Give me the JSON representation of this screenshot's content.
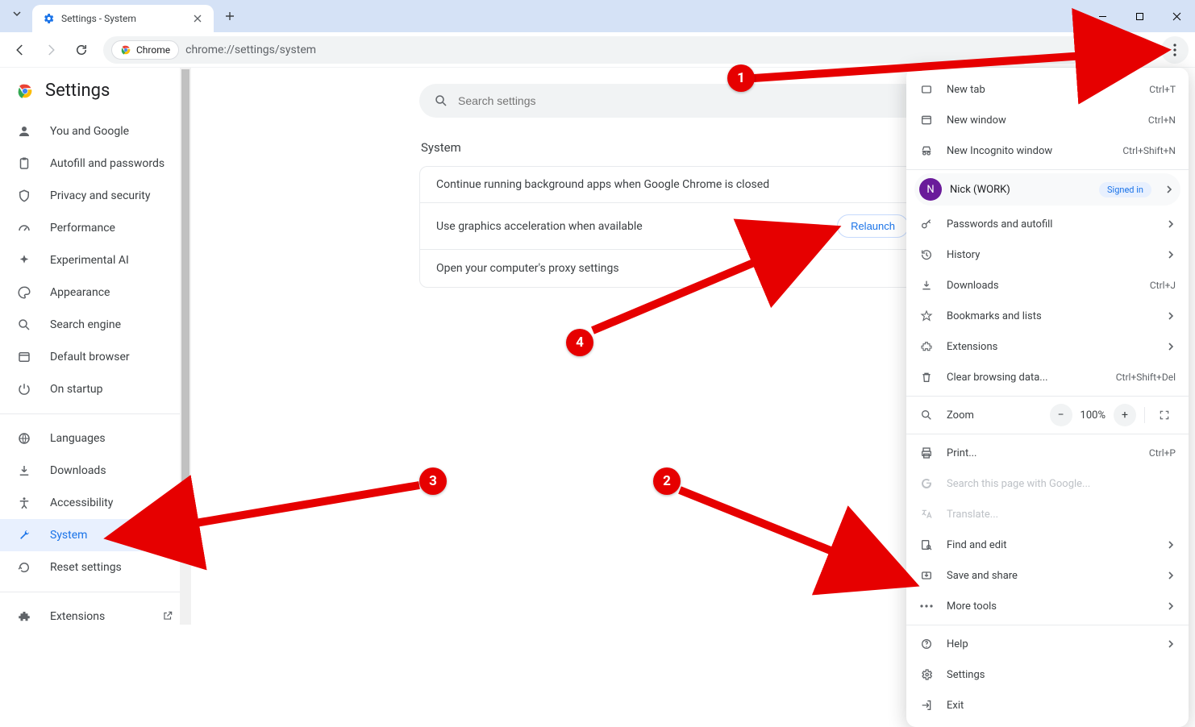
{
  "window": {
    "tab_title": "Settings - System",
    "new_tab_tooltip": "New tab"
  },
  "toolbar": {
    "chip_label": "Chrome",
    "url": "chrome://settings/system"
  },
  "sidebar": {
    "title": "Settings",
    "items": [
      {
        "label": "You and Google"
      },
      {
        "label": "Autofill and passwords"
      },
      {
        "label": "Privacy and security"
      },
      {
        "label": "Performance"
      },
      {
        "label": "Experimental AI"
      },
      {
        "label": "Appearance"
      },
      {
        "label": "Search engine"
      },
      {
        "label": "Default browser"
      },
      {
        "label": "On startup"
      }
    ],
    "items2": [
      {
        "label": "Languages"
      },
      {
        "label": "Downloads"
      },
      {
        "label": "Accessibility"
      },
      {
        "label": "System"
      },
      {
        "label": "Reset settings"
      }
    ],
    "extensions_label": "Extensions"
  },
  "content": {
    "search_placeholder": "Search settings",
    "section_title": "System",
    "row1": "Continue running background apps when Google Chrome is closed",
    "row2": "Use graphics acceleration when available",
    "relaunch": "Relaunch",
    "row3": "Open your computer's proxy settings"
  },
  "menu": {
    "new_tab": "New tab",
    "new_tab_k": "Ctrl+T",
    "new_window": "New window",
    "new_window_k": "Ctrl+N",
    "new_incognito": "New Incognito window",
    "new_incognito_k": "Ctrl+Shift+N",
    "profile_name": "Nick (WORK)",
    "profile_initial": "N",
    "signed_in": "Signed in",
    "passwords": "Passwords and autofill",
    "history": "History",
    "downloads": "Downloads",
    "downloads_k": "Ctrl+J",
    "bookmarks": "Bookmarks and lists",
    "extensions": "Extensions",
    "clear": "Clear browsing data...",
    "clear_k": "Ctrl+Shift+Del",
    "zoom_label": "Zoom",
    "zoom_val": "100%",
    "print": "Print...",
    "print_k": "Ctrl+P",
    "search_page": "Search this page with Google...",
    "translate": "Translate...",
    "find": "Find and edit",
    "save_share": "Save and share",
    "more_tools": "More tools",
    "help": "Help",
    "settings": "Settings",
    "exit": "Exit"
  },
  "badges": {
    "b1": "1",
    "b2": "2",
    "b3": "3",
    "b4": "4"
  }
}
